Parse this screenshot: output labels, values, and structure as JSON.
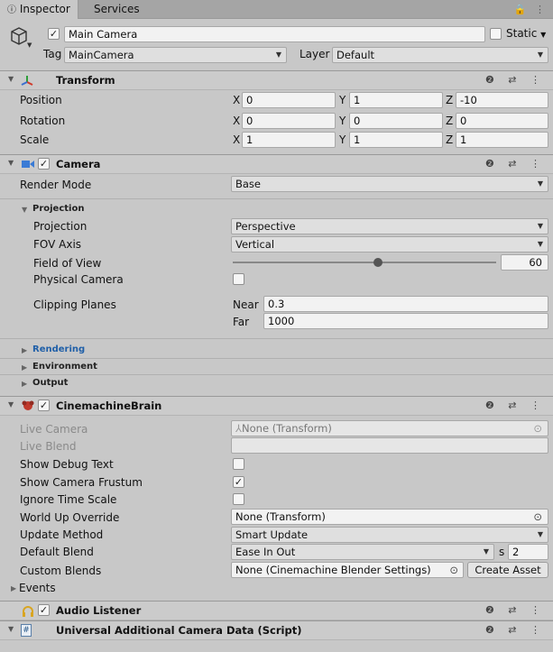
{
  "tabs": [
    {
      "label": "Inspector",
      "icon": "info-icon"
    },
    {
      "label": "Services"
    }
  ],
  "tabbar_icons": "🔒 ⋮",
  "object": {
    "name": "Main Camera",
    "static_label": "Static",
    "tag_label": "Tag",
    "tag_value": "MainCamera",
    "layer_label": "Layer",
    "layer_value": "Default"
  },
  "transform": {
    "title": "Transform",
    "rows": [
      {
        "label": "Position",
        "x": "0",
        "y": "1",
        "z": "-10"
      },
      {
        "label": "Rotation",
        "x": "0",
        "y": "0",
        "z": "0"
      },
      {
        "label": "Scale",
        "x": "1",
        "y": "1",
        "z": "1"
      }
    ],
    "axis": {
      "x": "X",
      "y": "Y",
      "z": "Z"
    }
  },
  "camera": {
    "title": "Camera",
    "render_mode_label": "Render Mode",
    "render_mode_value": "Base",
    "projection_section": "Projection",
    "projection_label": "Projection",
    "projection_value": "Perspective",
    "fov_axis_label": "FOV Axis",
    "fov_axis_value": "Vertical",
    "fov_label": "Field of View",
    "fov_value": "60",
    "fov_fraction": 0.55,
    "physical_label": "Physical Camera",
    "clipping_label": "Clipping Planes",
    "near_label": "Near",
    "near_value": "0.3",
    "far_label": "Far",
    "far_value": "1000",
    "rendering_section": "Rendering",
    "environment_section": "Environment",
    "output_section": "Output"
  },
  "brain": {
    "title": "CinemachineBrain",
    "live_camera_label": "Live Camera",
    "live_camera_value": "None (Transform)",
    "live_blend_label": "Live Blend",
    "show_debug_label": "Show Debug Text",
    "show_frustum_label": "Show Camera Frustum",
    "ignore_time_label": "Ignore Time Scale",
    "world_up_label": "World Up Override",
    "world_up_value": "None (Transform)",
    "update_method_label": "Update Method",
    "update_method_value": "Smart Update",
    "default_blend_label": "Default Blend",
    "default_blend_value": "Ease In Out",
    "default_blend_s_label": "s",
    "default_blend_s_value": "2",
    "custom_blends_label": "Custom Blends",
    "custom_blends_value": "None (Cinemachine Blender Settings)",
    "create_asset_label": "Create Asset",
    "events_label": "Events"
  },
  "audio": {
    "title": "Audio Listener"
  },
  "urp": {
    "title": "Universal Additional Camera Data (Script)"
  },
  "header_tools": "❷ ⇄ ⋮",
  "colors": {
    "camera_icon": "#3a7bd5",
    "audio_icon": "#d9a521",
    "brain_icon": "#c0392b",
    "link_blue": "#1f5fa8"
  }
}
